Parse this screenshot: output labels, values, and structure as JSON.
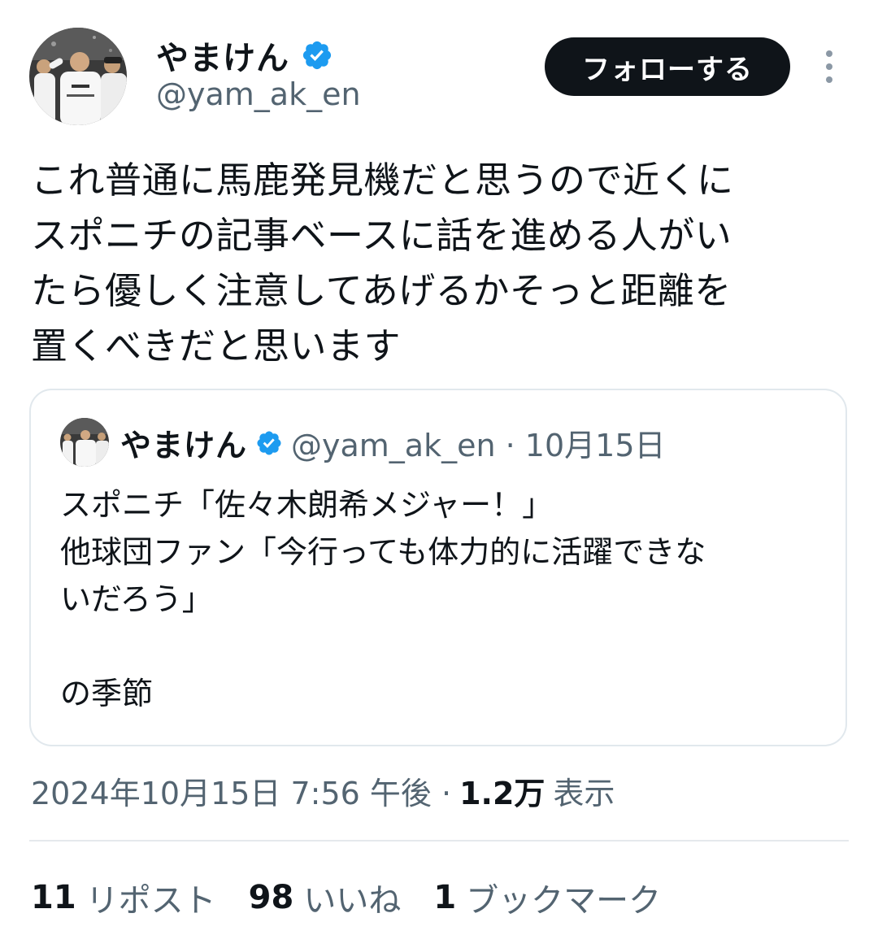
{
  "author": {
    "display_name": "やまけん",
    "handle": "@yam_ak_en",
    "avatar_icon": "profile-photo-baseball-players",
    "verified_icon": "verified-badge-icon"
  },
  "follow_button": {
    "label": "フォローする"
  },
  "more_icon": "more-vertical-icon",
  "tweet": {
    "text": "これ普通に馬鹿発見機だと思うので近くに\nスポニチの記事ベースに話を進める人がい\nたら優しく注意してあげるかそっと距離を\n置くべきだと思います"
  },
  "quoted_tweet": {
    "display_name": "やまけん",
    "meta": "@yam_ak_en · 10月15日",
    "text": "スポニチ「佐々木朗希メジャー！」\n他球団ファン「今行っても体力的に活躍できな\nいだろう」\n\nの季節"
  },
  "timestamp": {
    "datetime": "2024年10月15日 7:56 午後 · ",
    "views_count": "1.2万",
    "views_label": "表示"
  },
  "stats": {
    "reposts": {
      "count": "11",
      "label": "リポスト"
    },
    "likes": {
      "count": "98",
      "label": "いいね"
    },
    "bookmarks": {
      "count": "1",
      "label": "ブックマーク"
    }
  },
  "colors": {
    "text_primary": "#0f1419",
    "text_secondary": "#536471",
    "verified_blue": "#1d9bf0",
    "border": "#e1e8ed",
    "follow_bg": "#0f1419"
  }
}
